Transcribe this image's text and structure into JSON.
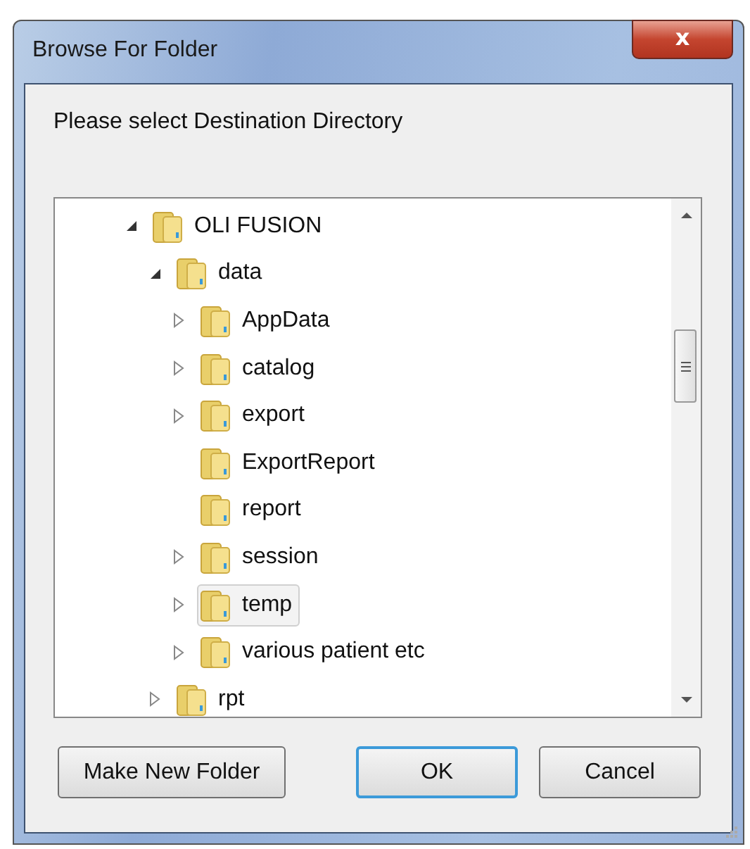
{
  "window": {
    "title": "Browse For Folder",
    "close_button": "x"
  },
  "prompt": "Please select Destination Directory",
  "tree": [
    {
      "label": "OLI FUSION",
      "expandable": true,
      "expanded": true,
      "selected": false,
      "children": [
        {
          "label": "data",
          "expandable": true,
          "expanded": true,
          "selected": false,
          "children": [
            {
              "label": "AppData",
              "expandable": true,
              "expanded": false,
              "selected": false
            },
            {
              "label": "catalog",
              "expandable": true,
              "expanded": false,
              "selected": false
            },
            {
              "label": "export",
              "expandable": true,
              "expanded": false,
              "selected": false
            },
            {
              "label": "ExportReport",
              "expandable": false,
              "selected": false
            },
            {
              "label": "report",
              "expandable": false,
              "selected": false
            },
            {
              "label": "session",
              "expandable": true,
              "expanded": false,
              "selected": false
            },
            {
              "label": "temp",
              "expandable": true,
              "expanded": false,
              "selected": true
            },
            {
              "label": "various patient etc",
              "expandable": true,
              "expanded": false,
              "selected": false
            }
          ]
        },
        {
          "label": "rpt",
          "expandable": true,
          "expanded": false,
          "selected": false
        }
      ]
    }
  ],
  "buttons": [
    {
      "label": "Make New Folder",
      "default": false
    },
    {
      "label": "OK",
      "default": true
    },
    {
      "label": "Cancel",
      "default": false
    }
  ]
}
